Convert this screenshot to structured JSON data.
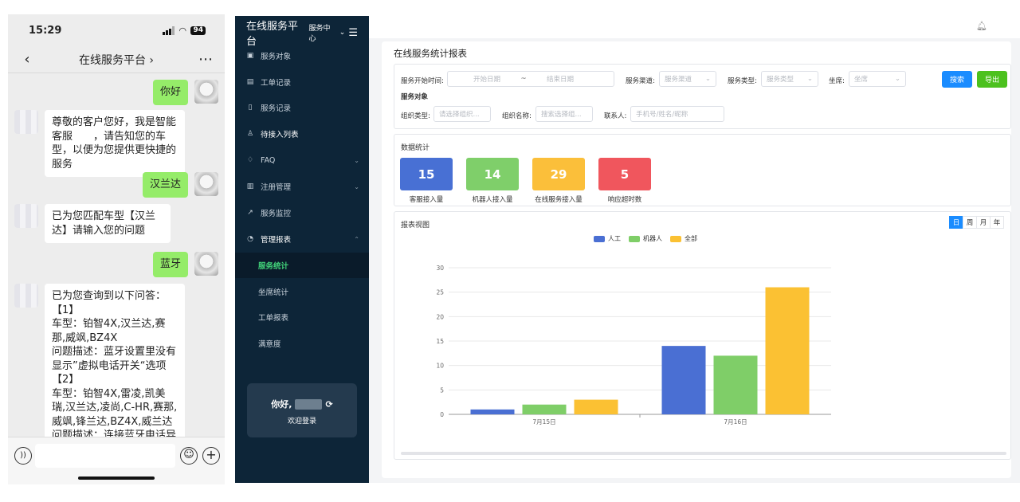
{
  "phone": {
    "time": "15:29",
    "battery": "94",
    "chat_title": "在线服务平台 ›",
    "messages": [
      {
        "from": "me",
        "text": "你好"
      },
      {
        "from": "bot",
        "text": "尊敬的客户您好，我是智能客服　　，请告知您的车型，以便为您提供更快捷的服务"
      },
      {
        "from": "me",
        "text": "汉兰达"
      },
      {
        "from": "bot",
        "text": "已为您匹配车型【汉兰达】请输入您的问题"
      },
      {
        "from": "me",
        "text": "蓝牙"
      },
      {
        "from": "bot",
        "text": "已为您查询到以下问答：\n【1】\n车型：铂智4X,汉兰达,赛那,威飒,BZ4X\n问题描述：蓝牙设置里没有显示”虚拟电话开关“选项\n【2】\n车型：铂智4X,雷凌,凯美瑞,汉兰达,凌尚,C-HR,赛那,威飒,锋兰达,BZ4X,威兰达\n问题描述：连接蓝牙电话异常"
      }
    ]
  },
  "sidebar": {
    "brand": "在线服务平台",
    "sub": "服务中心",
    "items": [
      {
        "label": "服务对象",
        "icon": "▣"
      },
      {
        "label": "工单记录",
        "icon": "▤"
      },
      {
        "label": "服务记录",
        "icon": "▯"
      },
      {
        "label": "待接入列表",
        "icon": "♙"
      },
      {
        "label": "FAQ",
        "icon": "♢"
      },
      {
        "label": "注册管理",
        "icon": "▥"
      },
      {
        "label": "服务监控",
        "icon": "↗"
      },
      {
        "label": "管理报表",
        "icon": "◔"
      }
    ],
    "subitems": [
      "服务统计",
      "坐席统计",
      "工单报表",
      "满意度"
    ],
    "greeting": "你好,",
    "welcome": "欢迎登录"
  },
  "main": {
    "title": "在线服务统计报表",
    "filters": {
      "start_label": "服务开始时间:",
      "start_ph": "开始日期",
      "tilde": "~",
      "end_ph": "结束日期",
      "channel_label": "服务渠道:",
      "channel_ph": "服务渠道",
      "type_label": "服务类型:",
      "type_ph": "服务类型",
      "seat_label": "坐席:",
      "seat_ph": "坐席",
      "search_btn": "搜索",
      "export_btn": "导出",
      "object_label": "服务对象",
      "org_type_label": "组织类型:",
      "org_type_ph": "请选择组织...",
      "org_name_label": "组织名称:",
      "org_name_ph": "搜索选择组...",
      "contact_label": "联系人:",
      "contact_ph": "手机号/姓名/昵称"
    },
    "stats_title": "数据统计",
    "stats": [
      {
        "value": "15",
        "label": "客服接入量",
        "color": "#4870d4"
      },
      {
        "value": "14",
        "label": "机器人接入量",
        "color": "#7fcf6a"
      },
      {
        "value": "29",
        "label": "在线服务接入量",
        "color": "#fbbf3a"
      },
      {
        "value": "5",
        "label": "响应超时数",
        "color": "#f0565d"
      }
    ],
    "report_title": "报表视图",
    "periods": [
      "日",
      "周",
      "月",
      "年"
    ]
  },
  "chart_data": {
    "type": "bar",
    "categories": [
      "7月15日",
      "7月16日"
    ],
    "series": [
      {
        "name": "人工",
        "values": [
          1,
          14
        ],
        "color": "#4a6fd3"
      },
      {
        "name": "机器人",
        "values": [
          2,
          12
        ],
        "color": "#7fce68"
      },
      {
        "name": "全部",
        "values": [
          3,
          26
        ],
        "color": "#fbc133"
      }
    ],
    "ylim": [
      0,
      30
    ],
    "yticks": [
      0,
      5,
      10,
      15,
      20,
      25,
      30
    ],
    "grid": true,
    "legend": "top-center"
  }
}
